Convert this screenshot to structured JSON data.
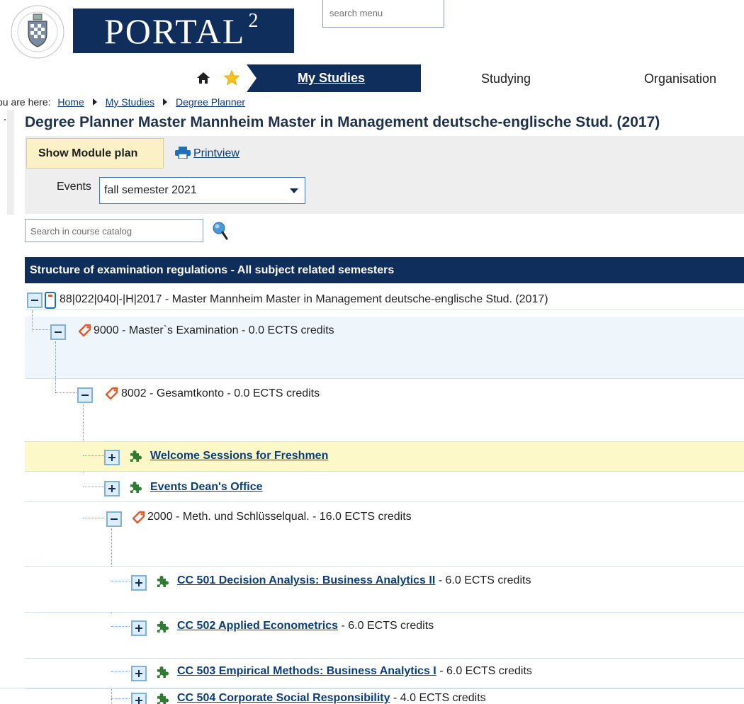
{
  "header": {
    "brand_name": "PORTAL",
    "brand_sup": "2",
    "seal_alt": "Universität Mannheim",
    "search_menu_placeholder": "search menu"
  },
  "nav": {
    "active": "My Studies",
    "items": [
      "Studying",
      "Organisation"
    ],
    "icons": [
      "home-icon",
      "star-icon"
    ]
  },
  "breadcrumb": {
    "prefix": "ou are here:",
    "items": [
      "Home",
      "My Studies",
      "Degree Planner"
    ]
  },
  "page": {
    "title": "Degree Planner Master Mannheim Master in Management deutsche-englische Stud. (2017)",
    "show_module_plan": "Show Module plan",
    "printview": "Printview",
    "events_label": "Events",
    "events_selected": "fall semester 2021",
    "catalog_search_placeholder": "Search in course catalog"
  },
  "tree": {
    "header": "Structure of examination regulations - All subject related semesters",
    "root": "88|022|040|-|H|2017 - Master Mannheim Master in Management deutsche-englische Stud. (2017)",
    "n9000": "9000 - Master`s Examination - 0.0 ECTS credits",
    "n8002": "8002 - Gesamtkonto - 0.0 ECTS credits",
    "welcome": "Welcome Sessions for Freshmen",
    "dean": "Events Dean's Office",
    "n2000": "2000 - Meth. und Schlüsselqual. - 16.0 ECTS credits",
    "courses": [
      {
        "title": "CC 501 Decision Analysis: Business Analytics II",
        "credits": " - 6.0 ECTS credits"
      },
      {
        "title": "CC 502 Applied Econometrics",
        "credits": " - 6.0 ECTS credits"
      },
      {
        "title": "CC 503 Empirical Methods: Business Analytics I",
        "credits": " - 6.0 ECTS credits"
      },
      {
        "title": "CC 504 Corporate Social Responsibility",
        "credits": " - 4.0 ECTS credits"
      }
    ]
  },
  "colors": {
    "navy": "#0f2e5c",
    "link": "#0b3d78",
    "row_blue": "#eef6fc",
    "row_yellow": "#fcf8c8",
    "tag_orange": "#e35a2a",
    "puzzle_green": "#2e7d32"
  }
}
